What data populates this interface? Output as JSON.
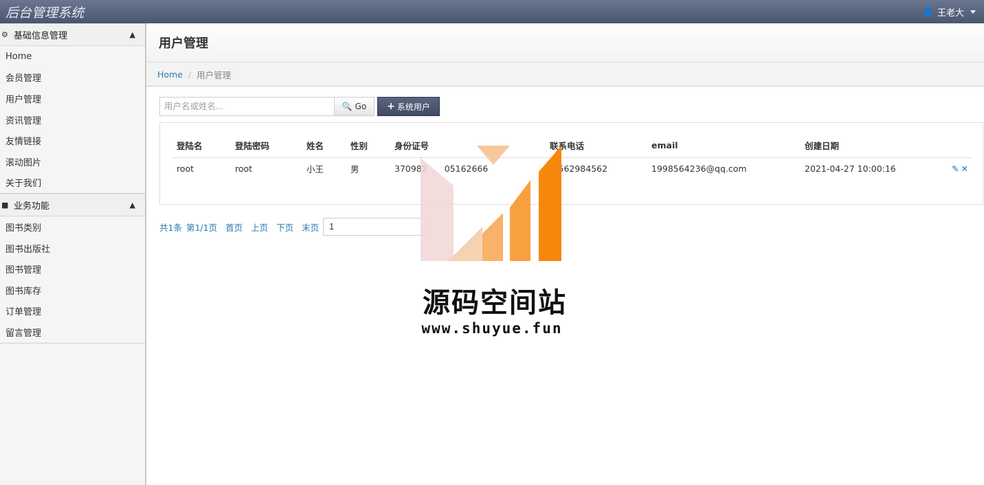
{
  "app": {
    "brand": "后台管理系统",
    "user_name": "王老大"
  },
  "sidebar": {
    "sections": [
      {
        "title": "基础信息管理",
        "items": [
          "Home",
          "会员管理",
          "用户管理",
          "资讯管理",
          "友情链接",
          "滚动图片",
          "关于我们"
        ]
      },
      {
        "title": "业务功能",
        "items": [
          "图书类别",
          "图书出版社",
          "图书管理",
          "图书库存",
          "订单管理",
          "留言管理"
        ]
      }
    ]
  },
  "page": {
    "title": "用户管理",
    "breadcrumb": {
      "home": "Home",
      "current": "用户管理"
    }
  },
  "toolbar": {
    "search_placeholder": "用户名或姓名...",
    "go_label": "Go",
    "add_label": "系统用户"
  },
  "table": {
    "headers": [
      "登陆名",
      "登陆密码",
      "姓名",
      "性别",
      "身份证号",
      "联系电话",
      "email",
      "创建日期"
    ],
    "rows": [
      [
        "root",
        "root",
        "小王",
        "男",
        "370982  05162666",
        " 562984562",
        "1998564236@qq.com",
        "2021-04-27 10:00:16"
      ]
    ]
  },
  "pager": {
    "total": "共1条",
    "page_info": "第1/1页",
    "first": "首页",
    "prev": "上页",
    "next": "下页",
    "last": "末页",
    "page_value": "1"
  },
  "watermark": {
    "title": "源码空间站",
    "url": "www.shuyue.fun"
  },
  "colors": {
    "topbar": "#4a5570",
    "link": "#2a7ab0",
    "add_button": "#3f4a63",
    "watermark_orange": "#f7931e"
  }
}
